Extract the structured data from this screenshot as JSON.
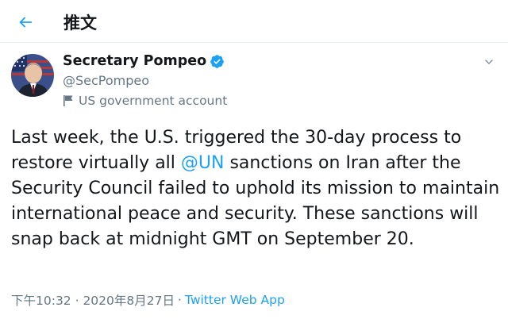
{
  "header": {
    "back_icon": "arrow-left-icon",
    "title": "推文"
  },
  "tweet": {
    "author": {
      "display_name": "Secretary Pompeo",
      "verified_icon": "verified-badge-icon",
      "handle": "@SecPompeo",
      "label_icon": "flag-icon",
      "label": "US government account"
    },
    "more_icon": "chevron-down-icon",
    "text_before_mention": "Last week, the U.S. triggered the 30-day process to restore virtually all ",
    "mention": "@UN",
    "text_after_mention": " sanctions on Iran after the Security Council failed to uphold its mission to maintain international peace and security. These sanctions will snap back at midnight GMT on September 20.",
    "timestamp": "下午10:32 · 2020年8月27日",
    "separator": "·",
    "source": "Twitter Web App"
  },
  "colors": {
    "accent": "#1da1f2",
    "text_primary": "#14171a",
    "text_secondary": "#657786",
    "border": "#e6ecf0"
  }
}
